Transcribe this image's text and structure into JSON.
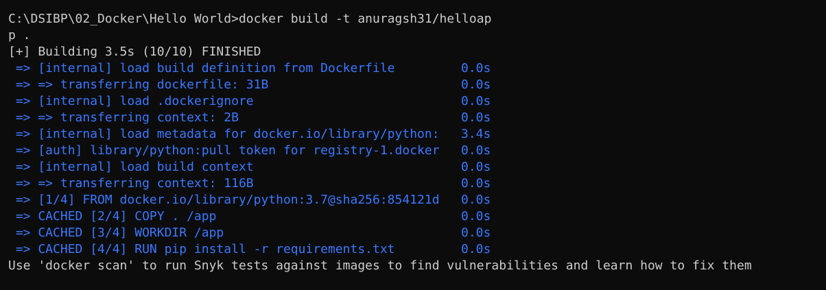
{
  "terminal": {
    "command_line_1": "C:\\DSIBP\\02_Docker\\Hello World>docker build -t anuragsh31/helloap",
    "command_line_2": "p .",
    "status": "[+] Building 3.5s (10/10) FINISHED",
    "steps": [
      {
        "desc": " => [internal] load build definition from Dockerfile",
        "dur": "0.0s"
      },
      {
        "desc": " => => transferring dockerfile: 31B",
        "dur": "0.0s"
      },
      {
        "desc": " => [internal] load .dockerignore",
        "dur": "0.0s"
      },
      {
        "desc": " => => transferring context: 2B",
        "dur": "0.0s"
      },
      {
        "desc": " => [internal] load metadata for docker.io/library/python:",
        "dur": "3.4s"
      },
      {
        "desc": " => [auth] library/python:pull token for registry-1.docker",
        "dur": "0.0s"
      },
      {
        "desc": " => [internal] load build context",
        "dur": "0.0s"
      },
      {
        "desc": " => => transferring context: 116B",
        "dur": "0.0s"
      },
      {
        "desc": " => [1/4] FROM docker.io/library/python:3.7@sha256:854121d",
        "dur": "0.0s"
      },
      {
        "desc": " => CACHED [2/4] COPY . /app",
        "dur": "0.0s"
      },
      {
        "desc": " => CACHED [3/4] WORKDIR /app",
        "dur": "0.0s"
      },
      {
        "desc": " => CACHED [4/4] RUN pip install -r requirements.txt",
        "dur": "0.0s"
      }
    ],
    "footer": "Use 'docker scan' to run Snyk tests against images to find vulnerabilities and learn how to fix them"
  },
  "colors": {
    "background": "#0c0c0c",
    "text": "#cccccc",
    "step_text": "#3b78ff"
  }
}
